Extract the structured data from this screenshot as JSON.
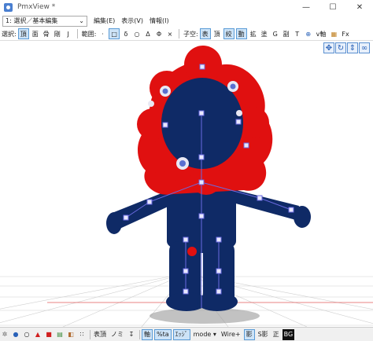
{
  "window": {
    "title": "PmxView *",
    "minimize": "—",
    "maximize": "☐",
    "close": "✕"
  },
  "menubar": {
    "mode_select": "1: 選択／基本編集",
    "edit": "編集(E)",
    "view": "表示(V)",
    "info": "情報(I)"
  },
  "toolbar": {
    "select_label": "選択:",
    "items_select": [
      "頂",
      "面",
      "骨",
      "剛",
      "J"
    ],
    "range_label": "範囲:",
    "range_shapes": [
      "□",
      "δ",
      "○",
      "Δ",
      "Φ"
    ],
    "tool_x": "×",
    "axis_label": "子空:",
    "items_axis": [
      "表",
      "頂",
      "絞",
      "動",
      "拡",
      "塗",
      "G",
      "副",
      "T"
    ],
    "v_axis": "v軸",
    "fx": "Fx"
  },
  "view_tools": {
    "move": "✥",
    "rotate": "↻",
    "zoom": "⇕",
    "link": "∞"
  },
  "statusbar": {
    "items_a": [
      "表頂",
      "ノミ"
    ],
    "items_b": [
      "軸",
      "%ta",
      "ｴｯｼﾞ"
    ],
    "mode": "mode ▾",
    "wire": "Wire+",
    "shadow_icon": "影",
    "shadow": "S影",
    "ortho": "正",
    "bg": "BG"
  },
  "colors": {
    "body": "#0f2a66",
    "hair": "#e01010",
    "bone": "#5f5fd6",
    "accent": "#2a62b8"
  }
}
